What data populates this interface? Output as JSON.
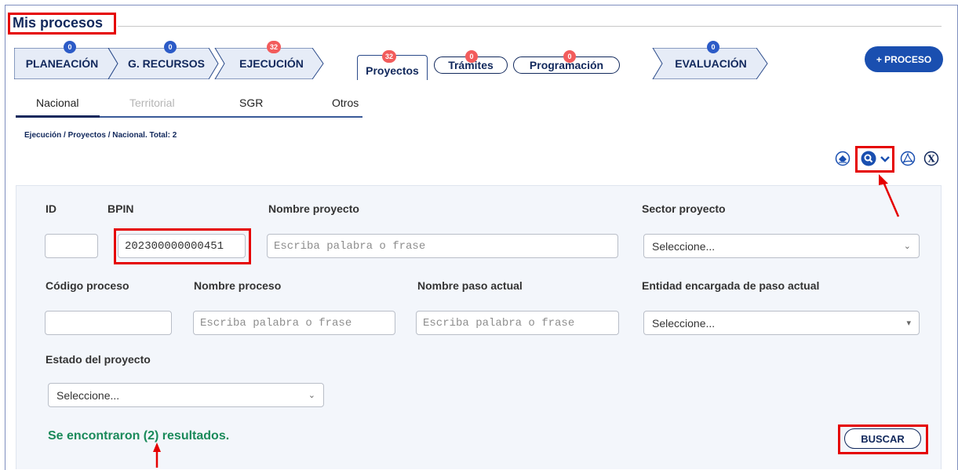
{
  "header": {
    "title": "Mis procesos"
  },
  "stages": [
    {
      "label": "PLANEACIÓN",
      "count": "0"
    },
    {
      "label": "G. RECURSOS",
      "count": "0"
    },
    {
      "label": "EJECUCIÓN",
      "count": "32"
    },
    {
      "label": "EVALUACIÓN",
      "count": "0"
    }
  ],
  "subtabs": [
    {
      "label": "Proyectos",
      "count": "32"
    },
    {
      "label": "Trámites",
      "count": "0"
    },
    {
      "label": "Programación",
      "count": "0"
    }
  ],
  "new_process_button": "+ PROCESO",
  "scope_tabs": [
    "Nacional",
    "Territorial",
    "SGR",
    "Otros"
  ],
  "breadcrumb": "Ejecución / Proyectos / Nacional. Total: 2",
  "toolbar": {
    "icons": [
      "eraser-icon",
      "search-icon",
      "chevron-down-icon",
      "pdf-icon",
      "excel-icon"
    ],
    "excel_glyph": "X"
  },
  "filters": {
    "id_label": "ID",
    "id_value": "",
    "bpin_label": "BPIN",
    "bpin_value": "202300000000451",
    "nombre_proyecto_label": "Nombre proyecto",
    "nombre_proyecto_placeholder": "Escriba palabra o frase",
    "sector_label": "Sector proyecto",
    "sector_value": "Seleccione...",
    "codigo_proceso_label": "Código proceso",
    "codigo_proceso_value": "",
    "nombre_proceso_label": "Nombre proceso",
    "nombre_proceso_placeholder": "Escriba palabra o frase",
    "nombre_paso_label": "Nombre paso actual",
    "nombre_paso_placeholder": "Escriba palabra o frase",
    "entidad_label": "Entidad encargada de paso actual",
    "entidad_value": "Seleccione...",
    "estado_label": "Estado del proyecto",
    "estado_value": "Seleccione..."
  },
  "results_text": "Se encontraron (2) resultados.",
  "search_button": "BUSCAR",
  "colors": {
    "navy": "#11285c",
    "accent_blue": "#1a4fb0",
    "annotation_red": "#e50000",
    "success_green": "#1a8a5a",
    "badge_red": "#f25c5c"
  }
}
